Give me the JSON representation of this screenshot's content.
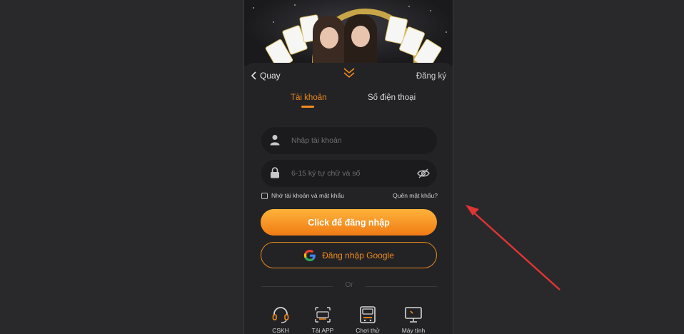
{
  "header": {
    "back_label": "Quay",
    "register_label": "Đăng ký"
  },
  "tabs": [
    {
      "label": "Tài khoản",
      "active": true
    },
    {
      "label": "Số điện thoại",
      "active": false
    }
  ],
  "form": {
    "username_placeholder": "Nhập tài khoản",
    "password_placeholder": "6-15 ký tự chữ và số",
    "remember_label": "Nhớ tài khoản và mật khẩu",
    "forgot_label": "Quên mật khẩu?",
    "login_button": "Click để đăng nhập",
    "google_button": "Đăng nhập Google",
    "or_label": "Or"
  },
  "bottom_nav": [
    {
      "label": "CSKH",
      "icon": "headset-icon"
    },
    {
      "label": "Tải APP",
      "icon": "app-download-icon"
    },
    {
      "label": "Chơi thử",
      "icon": "trial-play-icon"
    },
    {
      "label": "Máy tính",
      "icon": "computer-icon"
    }
  ],
  "colors": {
    "accent": "#f08a1c",
    "background": "#29292c",
    "panel": "#232326",
    "input_bg": "#1b1b1d",
    "annotation_arrow": "#e23434"
  }
}
